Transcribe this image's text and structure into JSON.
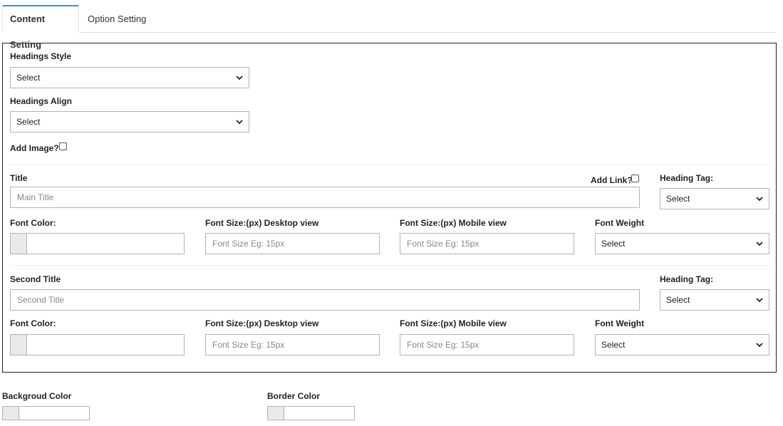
{
  "tabs": [
    {
      "label": "Content Setting",
      "active": true
    },
    {
      "label": "Option Setting",
      "active": false
    }
  ],
  "headings_style": {
    "label": "Headings Style",
    "value": "Select"
  },
  "headings_align": {
    "label": "Headings Align",
    "value": "Select"
  },
  "add_image": {
    "label": "Add Image?",
    "checked": false
  },
  "title_section": {
    "title_label": "Title",
    "title_placeholder": "Main Title",
    "add_link_label": "Add Link?",
    "heading_tag_label": "Heading Tag:",
    "heading_tag_value": "Select",
    "font_color_label": "Font Color:",
    "font_size_desktop_label": "Font Size:(px) Desktop view",
    "font_size_desktop_placeholder": "Font Size Eg: 15px",
    "font_size_mobile_label": "Font Size:(px) Mobile view",
    "font_size_mobile_placeholder": "Font Size Eg: 15px",
    "font_weight_label": "Font Weight",
    "font_weight_value": "Select"
  },
  "second_title_section": {
    "title_label": "Second Title",
    "title_placeholder": "Second Title",
    "heading_tag_label": "Heading Tag:",
    "heading_tag_value": "Select",
    "font_color_label": "Font Color:",
    "font_size_desktop_label": "Font Size:(px) Desktop view",
    "font_size_desktop_placeholder": "Font Size Eg: 15px",
    "font_size_mobile_label": "Font Size:(px) Mobile view",
    "font_size_mobile_placeholder": "Font Size Eg: 15px",
    "font_weight_label": "Font Weight",
    "font_weight_value": "Select"
  },
  "background_color": {
    "label": "Backgroud Color"
  },
  "border_color": {
    "label": "Border Color"
  },
  "colors": {
    "tab_accent": "#3b8fd0",
    "swatch": "#e9e9e9",
    "border": "#adb5bd"
  }
}
